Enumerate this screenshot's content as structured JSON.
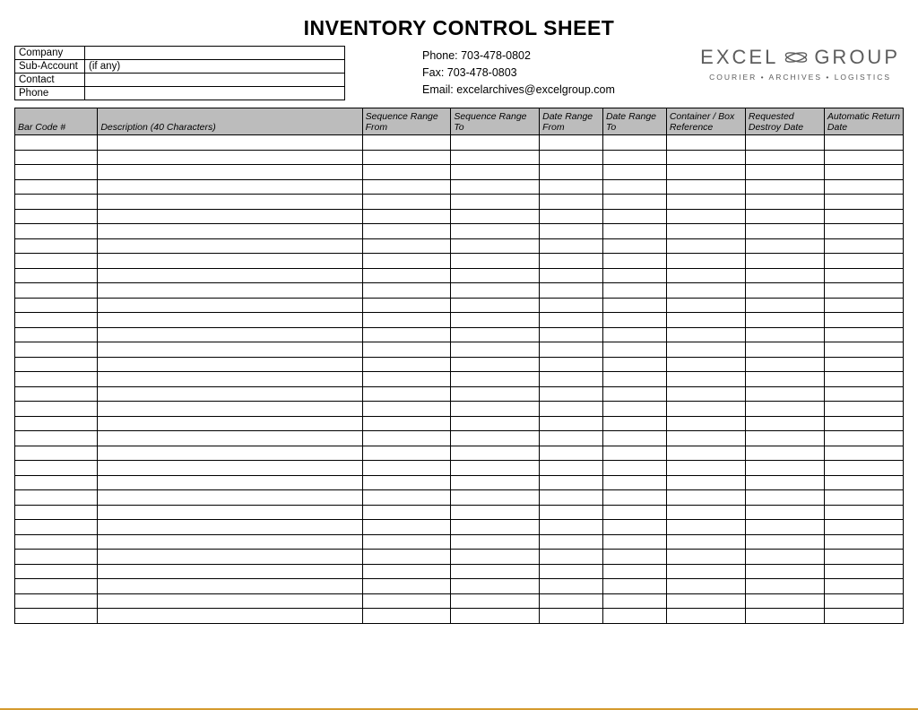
{
  "title": "INVENTORY CONTROL SHEET",
  "info_box": {
    "company_label": "Company",
    "company_value": "",
    "subaccount_label": "Sub-Account",
    "subaccount_hint": "(if any)",
    "contact_label": "Contact",
    "contact_value": "",
    "phone_label": "Phone",
    "phone_value": ""
  },
  "contact": {
    "phone_line": "Phone:  703-478-0802",
    "fax_line": "Fax:  703-478-0803",
    "email_line": "Email:  excelarchives@excelgroup.com"
  },
  "logo": {
    "word1": "EXCEL",
    "word2": "GROUP",
    "tagline": "COURIER • ARCHIVES • LOGISTICS"
  },
  "columns": {
    "bar": "Bar Code #",
    "desc": "Description (40 Characters)",
    "seqf": "Sequence Range From",
    "seqt": "Sequence Range To",
    "drf": "Date Range From",
    "drt": "Date Range To",
    "cont": "Container / Box Reference",
    "req": "Requested Destroy Date",
    "auto": "Automatic Return Date"
  },
  "row_count": 33
}
